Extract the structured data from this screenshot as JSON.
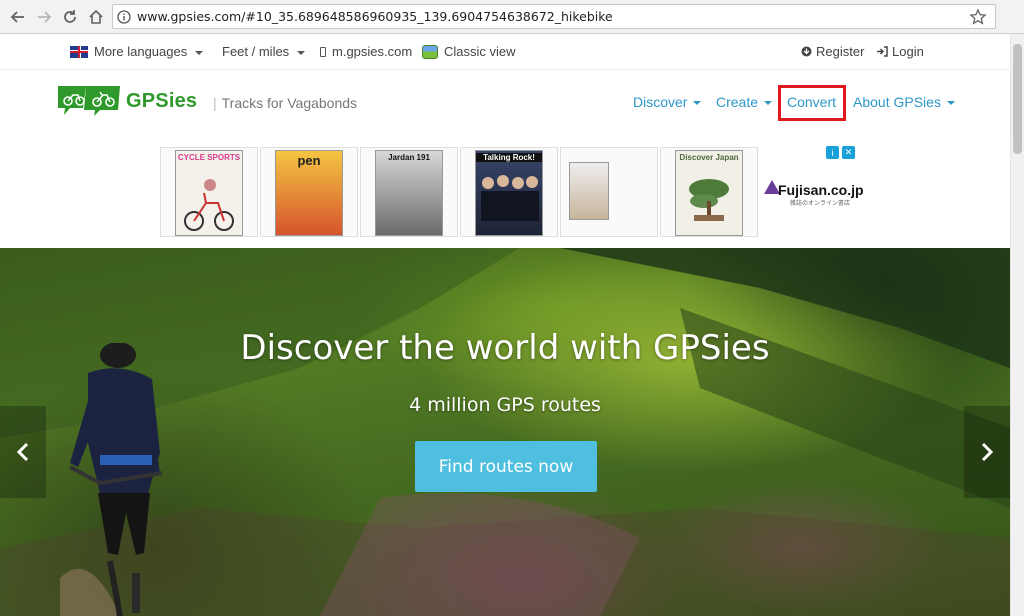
{
  "browser": {
    "url": "www.gpsies.com/#10_35.689648586960935_139.6904754638672_hikebike"
  },
  "topbar": {
    "languages": "More languages",
    "units": "Feet / miles",
    "mobile": "m.gpsies.com",
    "classic": "Classic view",
    "register": "Register",
    "login": "Login"
  },
  "header": {
    "brand": "GPSies",
    "tagline": "Tracks for Vagabonds",
    "menu": {
      "discover": "Discover",
      "create": "Create",
      "convert": "Convert",
      "about": "About GPSies"
    },
    "highlight_color": "#e0191f"
  },
  "ads": {
    "items": [
      {
        "title": "CYCLE SPORTS",
        "color": "#d83a8c"
      },
      {
        "title": "pen",
        "color": "#e9a532"
      },
      {
        "title": "Jardan 191",
        "color": "#3b3b3b"
      },
      {
        "title": "Talking Rock!",
        "color": "#25304a"
      },
      {
        "title": "",
        "color": "#8b6f52"
      },
      {
        "title": "Discover Japan",
        "color": "#5f8a4d"
      }
    ],
    "sponsor": "Fujisan.co.jp",
    "sponsor_sub": "雑誌のオンライン書店"
  },
  "hero": {
    "title": "Discover the world with GPSies",
    "subtitle": "4 million GPS routes",
    "cta": "Find routes now",
    "cta_color": "#4fbfe0"
  }
}
